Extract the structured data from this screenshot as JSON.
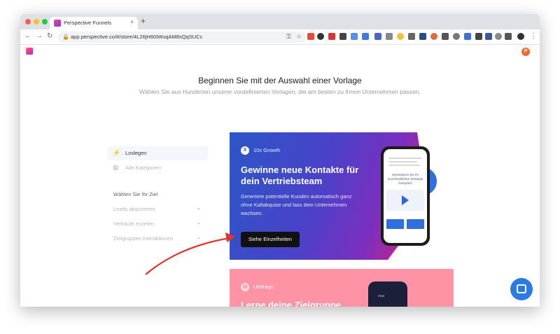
{
  "browser": {
    "tab_title": "Perspective Funnels",
    "tab_close": "×",
    "new_tab": "+",
    "url": "app.perspective.co/#/store/4L26jH60IWuqAM8sQqSUCc"
  },
  "header": {
    "avatar_initial": "P"
  },
  "intro": {
    "title": "Beginnen Sie mit der Auswahl einer Vorlage",
    "subtitle": "Wählen Sie aus Hunderten unserer vordefinierten Vorlagen, die am besten zu Ihrem Unternehmen passen."
  },
  "sidebar": {
    "items": [
      {
        "label": "Loslegen",
        "icon": "bolt-icon"
      },
      {
        "label": "Alle Kategorien",
        "icon": "grid-icon"
      }
    ],
    "goals_heading": "Wählen Sie Ihr Ziel",
    "goals": [
      {
        "label": "Leads akquirieren"
      },
      {
        "label": "Verkäufe erzielen"
      },
      {
        "label": "Zielgruppen Interaktionen"
      }
    ]
  },
  "cards": [
    {
      "badge_icon": "X",
      "badge": "10x Growth",
      "title": "Gewinne neue Kontakte für dein Vertriebsteam",
      "description": "Generiere potentielle Kunden automatisch ganz ohne Kaltakquise und lass dein Unternehmen wachsen.",
      "cta": "Siehe Einzelheiten",
      "phone_text": "Vereinbaren Sie Ihr unverbindliches Strategie Gespräch"
    },
    {
      "badge": "Umfrage",
      "title": "Lerne deine Zielgruppe",
      "phone_text": "Hey!"
    }
  ],
  "colors": {
    "card1_gradient": [
      "#2b57c7",
      "#7b2fbf",
      "#e02a5a"
    ],
    "card2_bg": "#ff93a6",
    "cta_bg": "#111111",
    "chat_button": "#2a7be4",
    "arrow": "#e0352b"
  }
}
